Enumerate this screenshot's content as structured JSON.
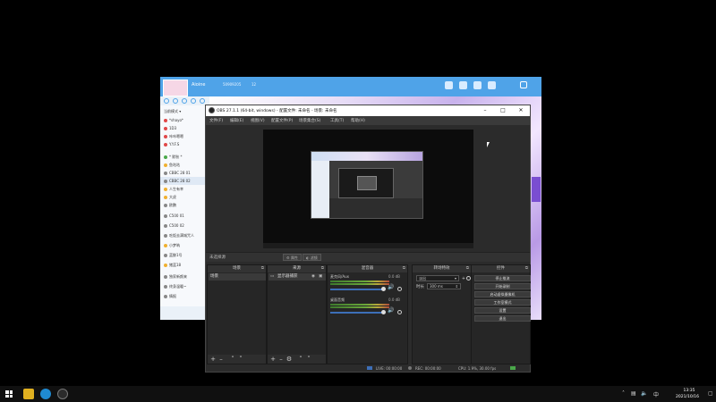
{
  "yy": {
    "name": "Aioine",
    "id": "50909205",
    "num": "12",
    "mode_label": "当前模式",
    "rows": [
      "*shayo*",
      "1D3",
      "咔咔嗯嗯",
      "Y.Y.F.S",
      "* 默秋 *",
      "鱼咕咕",
      "CBBC 28 01",
      "CBBC 28 02",
      "人生有幸",
      "大虎",
      "欧鹏",
      "C500 01",
      "C500 02",
      "吃饭去满城咒人",
      "小梦呐",
      "蓝鲸1号",
      "猪蓝18",
      "独家新颜来",
      "终身温暖~",
      "情报"
    ]
  },
  "obs": {
    "title": "OBS 27.1.1 (64-bit, windows) - 配置文件: 未命名 - 场景: 未命名",
    "menu": [
      "文件(F)",
      "编辑(E)",
      "视图(V)",
      "配置文件(P)",
      "场景集合(S)",
      "工具(T)",
      "帮助(H)"
    ],
    "no_source": "未选择源",
    "props_btn": "属性",
    "filters_btn": "滤镜",
    "docks": {
      "scenes": "场景",
      "sources": "来源",
      "mixer": "混音器",
      "transitions": "转场特效",
      "controls": "控件"
    },
    "scene_item": "场景",
    "source_item": "显示器捕获",
    "audio": [
      {
        "name": "麦克风/Aux",
        "db": "0.0 dB"
      },
      {
        "name": "桌面音频",
        "db": "0.0 dB"
      }
    ],
    "transition": {
      "value": "淡出",
      "duration_label": "时长",
      "duration_value": "300 ms"
    },
    "controls": [
      "停止推流",
      "开始录制",
      "启动虚拟摄像机",
      "工作室模式",
      "设置",
      "退出"
    ],
    "status": {
      "live": "LIVE: 00:00:00",
      "rec": "REC: 00:00:00",
      "cpu": "CPU: 1.9%, 30.00 fps"
    }
  },
  "taskbar": {
    "time": "13:35",
    "date": "2021/10/16",
    "lang": "中"
  }
}
